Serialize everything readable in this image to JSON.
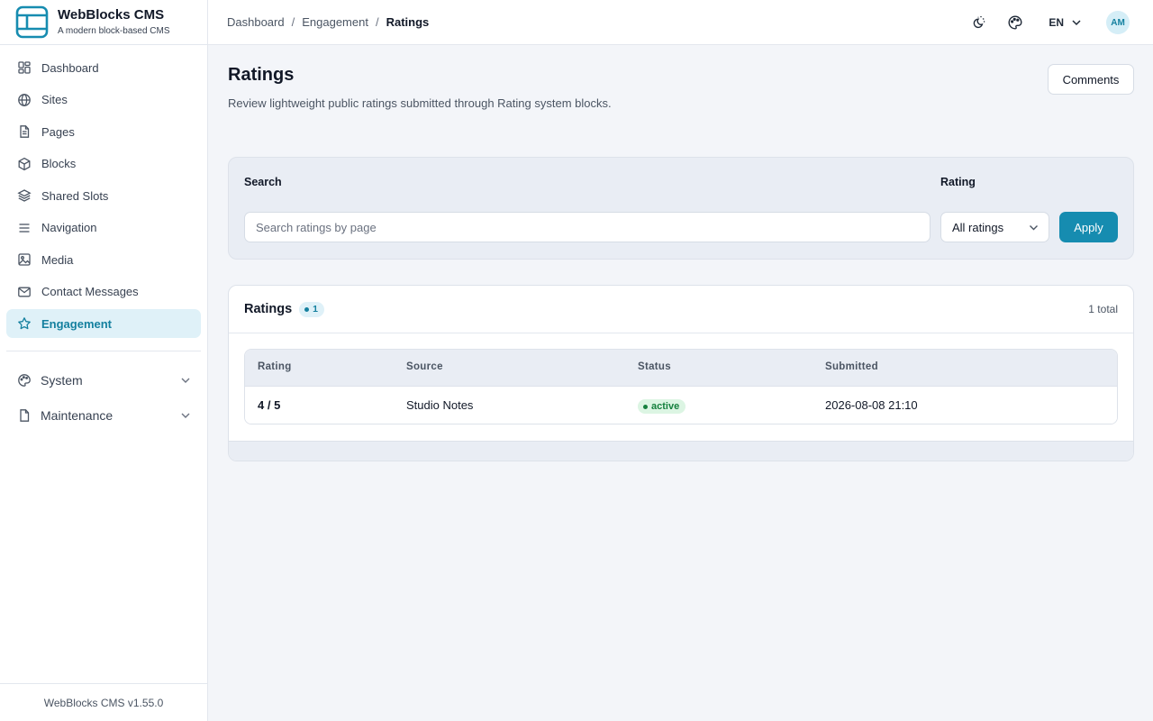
{
  "brand": {
    "name": "WebBlocks CMS",
    "tagline": "A modern block-based CMS"
  },
  "sidebar": {
    "items": [
      {
        "label": "Dashboard",
        "icon": "dashboard-icon"
      },
      {
        "label": "Sites",
        "icon": "globe-icon"
      },
      {
        "label": "Pages",
        "icon": "document-icon"
      },
      {
        "label": "Blocks",
        "icon": "cube-icon"
      },
      {
        "label": "Shared Slots",
        "icon": "layers-icon"
      },
      {
        "label": "Navigation",
        "icon": "menu-icon"
      },
      {
        "label": "Media",
        "icon": "image-icon"
      },
      {
        "label": "Contact Messages",
        "icon": "mail-icon"
      },
      {
        "label": "Engagement",
        "icon": "star-icon",
        "active": true
      }
    ],
    "groups": [
      {
        "label": "System",
        "icon": "palette-icon"
      },
      {
        "label": "Maintenance",
        "icon": "file-icon"
      }
    ],
    "footer": "WebBlocks CMS v1.55.0"
  },
  "breadcrumb": {
    "items": [
      "Dashboard",
      "Engagement"
    ],
    "current": "Ratings",
    "separator": "/"
  },
  "topbar": {
    "language": "EN",
    "avatar_initials": "AM"
  },
  "page": {
    "title": "Ratings",
    "subtitle": "Review lightweight public ratings submitted through Rating system blocks.",
    "comments_button": "Comments"
  },
  "filters": {
    "search_label": "Search",
    "search_placeholder": "Search ratings by page",
    "rating_label": "Rating",
    "rating_selected": "All ratings",
    "apply_label": "Apply"
  },
  "list": {
    "title": "Ratings",
    "count": "1",
    "total": "1 total",
    "columns": [
      "Rating",
      "Source",
      "Status",
      "Submitted"
    ],
    "rows": [
      {
        "rating": "4 / 5",
        "source": "Studio Notes",
        "status": "active",
        "submitted": "2026-08-08 21:10"
      }
    ]
  },
  "colors": {
    "accent": "#168cb0",
    "active_bg": "#dff1f8",
    "status_active": "#15803d"
  }
}
